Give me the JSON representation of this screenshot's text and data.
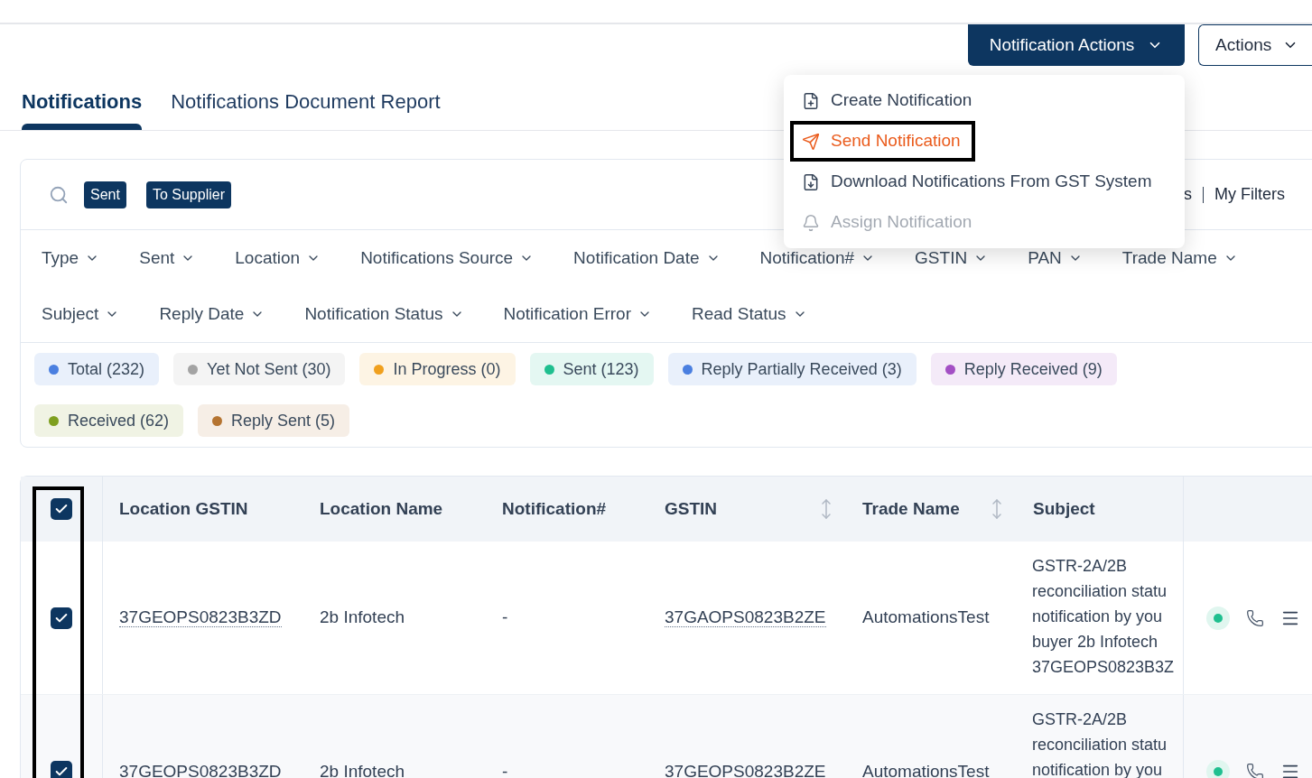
{
  "header_buttons": [
    {
      "label": "Notification Actions",
      "kind": "primary"
    },
    {
      "label": "Actions",
      "kind": "outline"
    }
  ],
  "menu": {
    "items": [
      {
        "label": "Create Notification",
        "kind": "create",
        "active": false,
        "disabled": false,
        "highlighted": false
      },
      {
        "label": "Send Notification",
        "kind": "send",
        "active": true,
        "disabled": false,
        "highlighted": true
      },
      {
        "label": "Download Notifications From GST System",
        "kind": "download",
        "active": false,
        "disabled": false,
        "highlighted": false
      },
      {
        "label": "Assign Notification",
        "kind": "assign",
        "active": false,
        "disabled": true,
        "highlighted": false
      }
    ]
  },
  "tabs": [
    {
      "label": "Notifications",
      "selected": true
    },
    {
      "label": "Notifications Document Report",
      "selected": false
    }
  ],
  "search": {
    "tags": [
      "Sent",
      "To Supplier"
    ]
  },
  "filter_links": [
    "s",
    "My Filters"
  ],
  "filter_rows": [
    [
      "Type",
      "Sent",
      "Location",
      "Notifications Source",
      "Notification Date",
      "Notification#",
      "GSTIN",
      "PAN",
      "Trade Name"
    ],
    [
      "Subject",
      "Reply Date",
      "Notification Status",
      "Notification Error",
      "Read Status"
    ]
  ],
  "status_chips": [
    {
      "label": "Total (232)",
      "color": "#4a7fe0"
    },
    {
      "label": "Yet Not Sent (30)",
      "color": "#a3a3a3"
    },
    {
      "label": "In Progress (0)",
      "color": "#f0a01e"
    },
    {
      "label": "Sent (123)",
      "color": "#1fbf8f"
    },
    {
      "label": "Reply Partially Received (3)",
      "color": "#4a7fe0"
    },
    {
      "label": "Reply Received (9)",
      "color": "#a34fc4"
    },
    {
      "label": "Received (62)",
      "color": "#7e9f1f"
    },
    {
      "label": "Reply Sent (5)",
      "color": "#b57431"
    }
  ],
  "table": {
    "all_checked": true,
    "checkbox_column_highlighted": true,
    "columns": [
      {
        "label": "Location GSTIN",
        "sortable": false
      },
      {
        "label": "Location Name",
        "sortable": false
      },
      {
        "label": "Notification#",
        "sortable": false
      },
      {
        "label": "GSTIN",
        "sortable": true
      },
      {
        "label": "Trade Name",
        "sortable": true
      },
      {
        "label": "Subject",
        "sortable": false
      }
    ],
    "rows": [
      {
        "checked": true,
        "location_gstin": "37GEOPS0823B3ZD",
        "location_name": "2b Infotech",
        "notification": "-",
        "gstin": "37GAOPS0823B2ZE",
        "trade_name": "AutomationsTest",
        "subject_lines": [
          "GSTR-2A/2B",
          "reconciliation statu",
          "notification by you",
          "buyer 2b Infotech",
          "37GEOPS0823B3Z"
        ],
        "color": "#1fbf8f"
      },
      {
        "checked": true,
        "location_gstin": "37GEOPS0823B3ZD",
        "location_name": "2b Infotech",
        "notification": "-",
        "gstin": "37GEOPS0823B2ZE",
        "trade_name": "AutomationsTest",
        "subject_lines": [
          "GSTR-2A/2B",
          "reconciliation statu",
          "notification by you"
        ],
        "color": "#1fbf8f"
      }
    ]
  }
}
